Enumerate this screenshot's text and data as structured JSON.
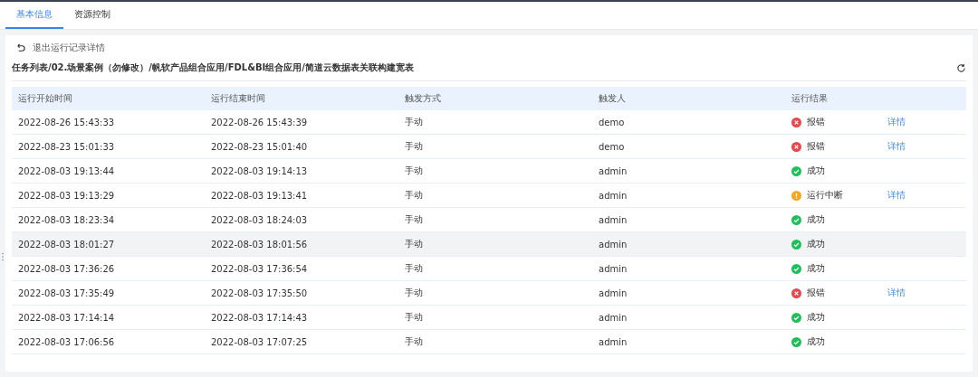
{
  "tabs": [
    {
      "label": "基本信息",
      "selected": true
    },
    {
      "label": "资源控制",
      "selected": false
    }
  ],
  "back_link": "退出运行记录详情",
  "breadcrumb": "任务列表/02.场景案例（勿修改）/帆软产品组合应用/FDL&BI组合应用/简道云数据表关联构建宽表",
  "table": {
    "columns": [
      "运行开始时间",
      "运行结束时间",
      "触发方式",
      "触发人",
      "运行结果"
    ],
    "rows": [
      {
        "start": "2022-08-26 15:43:33",
        "end": "2022-08-26 15:43:39",
        "trigger": "手动",
        "user": "demo",
        "result": {
          "kind": "error",
          "text": "报错"
        },
        "detail": "详情",
        "hovered": false
      },
      {
        "start": "2022-08-23 15:01:33",
        "end": "2022-08-23 15:01:40",
        "trigger": "手动",
        "user": "demo",
        "result": {
          "kind": "error",
          "text": "报错"
        },
        "detail": "详情",
        "hovered": false
      },
      {
        "start": "2022-08-03 19:13:44",
        "end": "2022-08-03 19:14:13",
        "trigger": "手动",
        "user": "admin",
        "result": {
          "kind": "success",
          "text": "成功"
        },
        "hovered": false
      },
      {
        "start": "2022-08-03 19:13:29",
        "end": "2022-08-03 19:13:41",
        "trigger": "手动",
        "user": "admin",
        "result": {
          "kind": "warning",
          "text": "运行中断"
        },
        "detail": "详情",
        "hovered": false
      },
      {
        "start": "2022-08-03 18:23:34",
        "end": "2022-08-03 18:24:03",
        "trigger": "手动",
        "user": "admin",
        "result": {
          "kind": "success",
          "text": "成功"
        },
        "hovered": false
      },
      {
        "start": "2022-08-03 18:01:27",
        "end": "2022-08-03 18:01:56",
        "trigger": "手动",
        "user": "admin",
        "result": {
          "kind": "success",
          "text": "成功"
        },
        "hovered": true
      },
      {
        "start": "2022-08-03 17:36:26",
        "end": "2022-08-03 17:36:54",
        "trigger": "手动",
        "user": "admin",
        "result": {
          "kind": "success",
          "text": "成功"
        },
        "hovered": false
      },
      {
        "start": "2022-08-03 17:35:49",
        "end": "2022-08-03 17:35:50",
        "trigger": "手动",
        "user": "admin",
        "result": {
          "kind": "error",
          "text": "报错"
        },
        "detail": "详情",
        "hovered": false
      },
      {
        "start": "2022-08-03 17:14:14",
        "end": "2022-08-03 17:14:43",
        "trigger": "手动",
        "user": "admin",
        "result": {
          "kind": "success",
          "text": "成功"
        },
        "hovered": false
      },
      {
        "start": "2022-08-03 17:06:56",
        "end": "2022-08-03 17:07:25",
        "trigger": "手动",
        "user": "admin",
        "result": {
          "kind": "success",
          "text": "成功"
        },
        "hovered": false
      }
    ]
  }
}
